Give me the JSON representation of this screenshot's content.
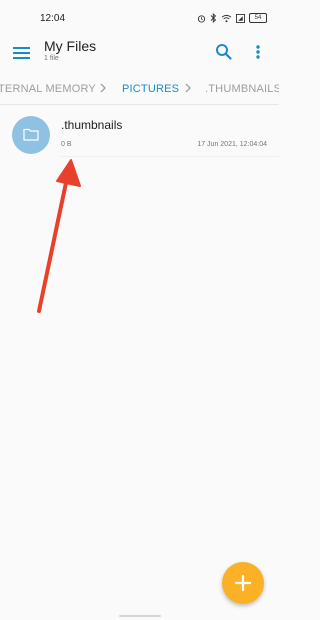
{
  "status": {
    "time": "12:04",
    "battery": "54"
  },
  "appbar": {
    "title": "My Files",
    "subtitle": "1 file"
  },
  "breadcrumb": {
    "items": [
      {
        "label": "TERNAL MEMORY"
      },
      {
        "label": "PICTURES"
      },
      {
        "label": ".THUMBNAILS"
      }
    ]
  },
  "files": [
    {
      "name": ".thumbnails",
      "size": "0 B",
      "date": "17 Jun 2021, 12:04:04"
    }
  ],
  "colors": {
    "accent": "#1a8cc4",
    "folder": "#8ec1e2",
    "fab": "#fbb126",
    "arrow": "#e8402a"
  },
  "icons": {
    "menu": "menu-icon",
    "search": "search-icon",
    "more": "more-vert-icon",
    "folder": "folder-icon",
    "add": "plus-icon",
    "separator": "chevron-right-icon"
  }
}
